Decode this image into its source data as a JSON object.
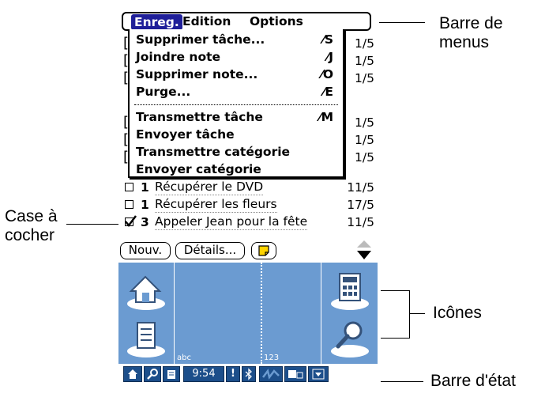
{
  "menu": {
    "titles": [
      "Enreg.",
      "Edition",
      "Options"
    ],
    "items": [
      {
        "label": "Supprimer tâche...",
        "shortcut": "⁄S"
      },
      {
        "label": "Joindre note",
        "shortcut": "⁄J"
      },
      {
        "label": "Supprimer note...",
        "shortcut": "⁄O"
      },
      {
        "label": "Purge...",
        "shortcut": "⁄E"
      },
      {
        "label": "Transmettre tâche",
        "shortcut": "⁄M"
      },
      {
        "label": "Envoyer tâche",
        "shortcut": ""
      },
      {
        "label": "Transmettre catégorie",
        "shortcut": ""
      },
      {
        "label": "Envoyer catégorie",
        "shortcut": ""
      }
    ]
  },
  "tasks": {
    "hidden_dates": [
      "1/5",
      "1/5",
      "1/5",
      "1/5",
      "1/5",
      "1/5"
    ],
    "rows": [
      {
        "checked": false,
        "priority": "1",
        "desc": "Récupérer le DVD",
        "date": "11/5"
      },
      {
        "checked": false,
        "priority": "1",
        "desc": "Récupérer les fleurs",
        "date": "17/5"
      },
      {
        "checked": true,
        "priority": "3",
        "desc": "Appeler Jean pour la fête",
        "date": "11/5"
      }
    ]
  },
  "buttons": {
    "new": "Nouv.",
    "details": "Détails..."
  },
  "graffiti": {
    "abc": "abc",
    "num": "123"
  },
  "status": {
    "time": "9:54",
    "alert": "!"
  },
  "callouts": {
    "menubar": "Barre de\nmenus",
    "checkbox": "Case à\ncocher",
    "icons": "Icônes",
    "statusbar": "Barre d'état"
  }
}
